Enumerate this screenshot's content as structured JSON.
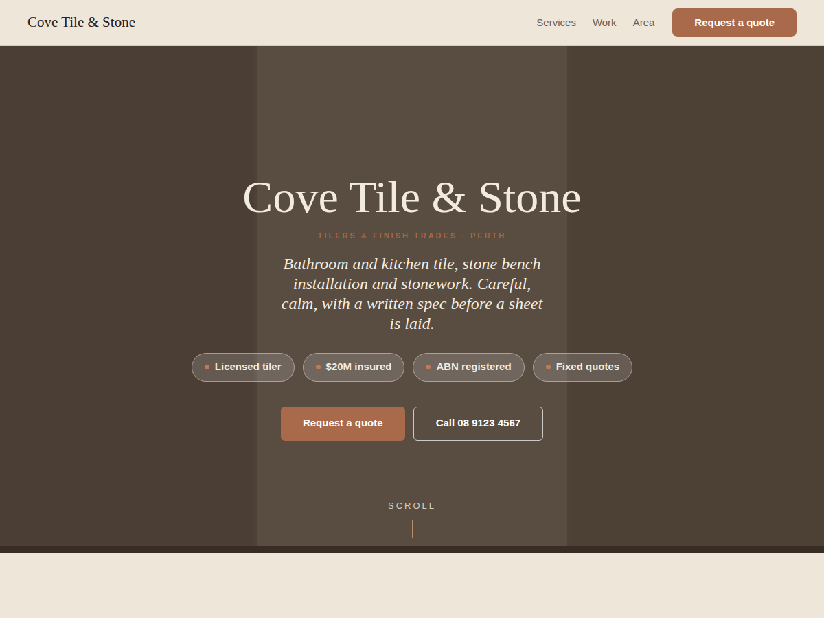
{
  "header": {
    "brand": "Cove Tile & Stone",
    "nav": [
      "Services",
      "Work",
      "Area"
    ],
    "cta": "Request a quote"
  },
  "hero": {
    "title": "Cove Tile & Stone",
    "eyebrow": "TILERS & FINISH TRADES · PERTH",
    "tagline": "Bathroom and kitchen tile, stone bench installation and stonework. Careful, calm, with a written spec before a sheet is laid.",
    "badges": [
      "Licensed tiler",
      "$20M insured",
      "ABN registered",
      "Fixed quotes"
    ],
    "primary_button": "Request a quote",
    "secondary_button": "Call 08 9123 4567",
    "scroll": "SCROLL"
  }
}
